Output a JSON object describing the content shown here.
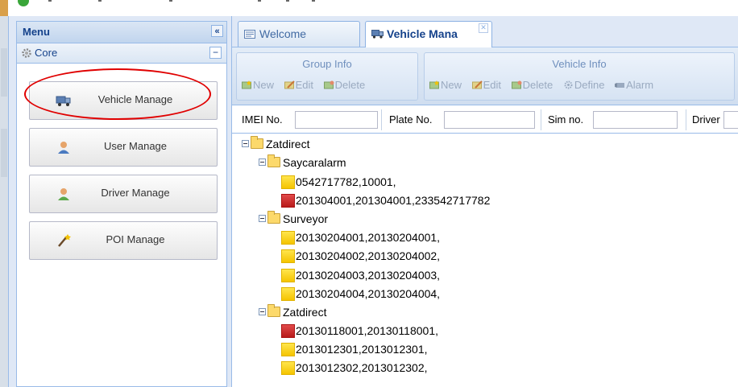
{
  "menu": {
    "title": "Menu",
    "collapse_icon": "«",
    "section": {
      "label": "Core",
      "collapse_icon": "−"
    },
    "buttons": [
      {
        "label": "Vehicle Manage",
        "icon": "truck-icon"
      },
      {
        "label": "User Manage",
        "icon": "user-icon"
      },
      {
        "label": "Driver Manage",
        "icon": "driver-icon"
      },
      {
        "label": "POI Manage",
        "icon": "wand-icon"
      }
    ]
  },
  "tabs": [
    {
      "label": "Welcome",
      "active": false
    },
    {
      "label": "Vehicle Mana",
      "active": true,
      "close": "✕"
    }
  ],
  "toolbar": {
    "group_info": {
      "title": "Group Info",
      "buttons": [
        "New",
        "Edit",
        "Delete"
      ]
    },
    "vehicle_info": {
      "title": "Vehicle Info",
      "buttons": [
        "New",
        "Edit",
        "Delete",
        "Define",
        "Alarm"
      ]
    }
  },
  "search": {
    "imei_label": "IMEI No.",
    "imei_value": "",
    "plate_label": "Plate No.",
    "plate_value": "",
    "sim_label": "Sim no.",
    "sim_value": "",
    "driver_label": "Driver",
    "driver_value": ""
  },
  "tree": {
    "root": "Zatdirect",
    "groups": [
      {
        "name": "Saycaralarm",
        "items": [
          {
            "text": "0542717782,10001,",
            "status": "yellow"
          },
          {
            "text": "201304001,201304001,233542717782",
            "status": "red"
          }
        ]
      },
      {
        "name": "Surveyor",
        "items": [
          {
            "text": "20130204001,20130204001,",
            "status": "yellow"
          },
          {
            "text": "20130204002,20130204002,",
            "status": "yellow"
          },
          {
            "text": "20130204003,20130204003,",
            "status": "yellow"
          },
          {
            "text": "20130204004,20130204004,",
            "status": "yellow"
          }
        ]
      },
      {
        "name": "Zatdirect",
        "items": [
          {
            "text": "20130118001,20130118001,",
            "status": "red"
          },
          {
            "text": "2013012301,2013012301,",
            "status": "yellow"
          },
          {
            "text": "2013012302,2013012302,",
            "status": "yellow"
          }
        ]
      }
    ]
  },
  "colors": {
    "status_yellow": "#f5c400",
    "status_red": "#c02020",
    "highlight_ring": "#e00000"
  }
}
